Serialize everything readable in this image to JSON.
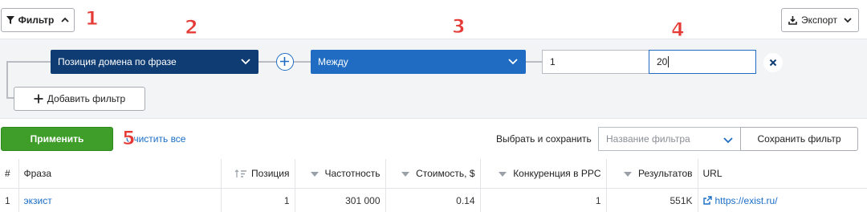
{
  "toolbar": {
    "filter_label": "Фильтр",
    "export_label": "Экспорт"
  },
  "annotations": [
    "1",
    "2",
    "3",
    "4",
    "5"
  ],
  "filter": {
    "field_select": "Позиция домена по фразе",
    "operator_select": "Между",
    "value_from": "1",
    "value_to": "20",
    "add_filter_label": "Добавить фильтр"
  },
  "actions": {
    "apply_label": "Применить",
    "clear_all_label": "Очистить все",
    "choose_save_label": "Выбрать и сохранить",
    "filter_name_placeholder": "Название фильтра",
    "save_filter_label": "Сохранить фильтр"
  },
  "table": {
    "columns": [
      "#",
      "Фраза",
      "Позиция",
      "Частотность",
      "Стоимость, $",
      "Конкуренция в PPC",
      "Результатов",
      "URL"
    ],
    "rows": [
      {
        "num": "1",
        "phrase": "экзист",
        "position": "1",
        "frequency": "301 000",
        "cost": "0.14",
        "competition": "1",
        "results": "551K",
        "url": "https://exist.ru/"
      }
    ]
  },
  "colors": {
    "field_select_bg": "#0f3d73",
    "operator_select_bg": "#1f6cc2",
    "apply_bg": "#3f9d2a",
    "annotation_red": "#e53935",
    "link_blue": "#1a6ec6"
  }
}
